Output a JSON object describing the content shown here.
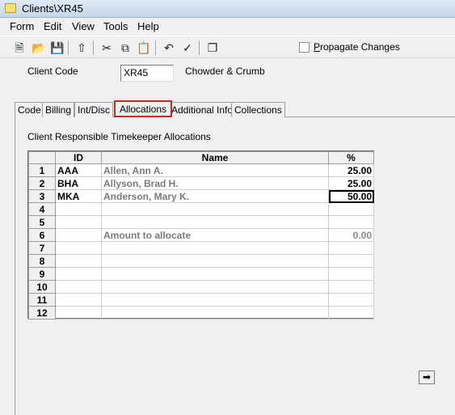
{
  "window": {
    "title": "Clients\\XR45"
  },
  "menu": [
    "Form",
    "Edit",
    "View",
    "Tools",
    "Help"
  ],
  "toolbar": {
    "icons": [
      "new-document-icon",
      "open-folder-icon",
      "save-icon",
      "upload-icon",
      "cut-icon",
      "copy-icon",
      "paste-icon",
      "undo-icon",
      "spellcheck-icon",
      "windows-icon"
    ]
  },
  "propagate": {
    "label_prefix": "P",
    "label_rest": "ropagate Changes",
    "checked": false
  },
  "client": {
    "code_label": "Client Code",
    "code_value": "XR45",
    "name": "Chowder & Crumb"
  },
  "tabs": [
    "Code",
    "Billing",
    "Int/Disc",
    "Allocations",
    "Additional Info",
    "Collections"
  ],
  "active_tab": "Allocations",
  "panel": {
    "section_label": "Client Responsible Timekeeper Allocations"
  },
  "grid": {
    "headers": [
      "",
      "ID",
      "Name",
      "%"
    ],
    "rows": [
      {
        "num": "1",
        "id": "AAA",
        "name": "Allen, Ann A.",
        "pct": "25.00"
      },
      {
        "num": "2",
        "id": "BHA",
        "name": "Allyson, Brad H.",
        "pct": "25.00"
      },
      {
        "num": "3",
        "id": "MKA",
        "name": "Anderson, Mary K.",
        "pct": "50.00"
      },
      {
        "num": "4",
        "id": "",
        "name": "",
        "pct": ""
      },
      {
        "num": "5",
        "id": "",
        "name": "",
        "pct": ""
      },
      {
        "num": "6",
        "id": "",
        "name": "Amount to allocate",
        "pct": "0.00"
      },
      {
        "num": "7",
        "id": "",
        "name": "",
        "pct": ""
      },
      {
        "num": "8",
        "id": "",
        "name": "",
        "pct": ""
      },
      {
        "num": "9",
        "id": "",
        "name": "",
        "pct": ""
      },
      {
        "num": "10",
        "id": "",
        "name": "",
        "pct": ""
      },
      {
        "num": "11",
        "id": "",
        "name": "",
        "pct": ""
      },
      {
        "num": "12",
        "id": "",
        "name": "",
        "pct": ""
      }
    ]
  },
  "colors": {
    "active_tab_border": "#c0272d",
    "muted_text": "#7a7a7a"
  }
}
